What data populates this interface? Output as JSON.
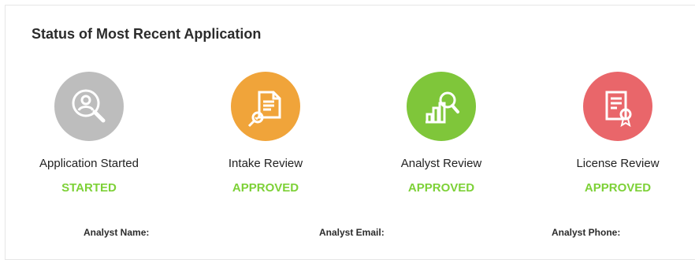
{
  "title": "Status of Most Recent Application",
  "steps": [
    {
      "label": "Application Started",
      "status": "STARTED",
      "icon": "user-search-icon",
      "color": "#bdbdbd"
    },
    {
      "label": "Intake Review",
      "status": "APPROVED",
      "icon": "document-check-icon",
      "color": "#f0a43a"
    },
    {
      "label": "Analyst Review",
      "status": "APPROVED",
      "icon": "chart-search-icon",
      "color": "#7fc63a"
    },
    {
      "label": "License Review",
      "status": "APPROVED",
      "icon": "certificate-icon",
      "color": "#e9666a"
    }
  ],
  "analyst": {
    "name_label": "Analyst Name:",
    "email_label": "Analyst Email:",
    "phone_label": "Analyst Phone:"
  },
  "colors": {
    "status_green": "#7dd137"
  }
}
